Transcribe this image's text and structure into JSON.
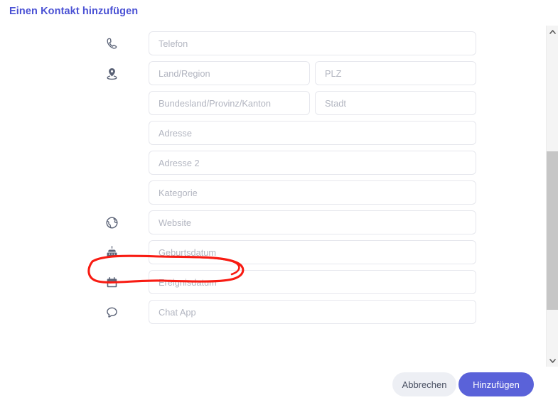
{
  "dialog": {
    "title": "Einen Kontakt hinzufügen"
  },
  "form": {
    "rows": [
      {
        "icon": "phone-icon",
        "fields": [
          {
            "name": "phone-input",
            "placeholder": "Telefon",
            "width": "full"
          }
        ]
      },
      {
        "icon": "location-pin-icon",
        "fields": [
          {
            "name": "country-region-input",
            "placeholder": "Land/Region",
            "width": "left"
          },
          {
            "name": "postal-code-input",
            "placeholder": "PLZ",
            "width": "right"
          }
        ]
      },
      {
        "icon": null,
        "fields": [
          {
            "name": "state-province-input",
            "placeholder": "Bundesland/Provinz/Kanton",
            "width": "left"
          },
          {
            "name": "city-input",
            "placeholder": "Stadt",
            "width": "right"
          }
        ]
      },
      {
        "icon": null,
        "fields": [
          {
            "name": "address-input",
            "placeholder": "Adresse",
            "width": "full"
          }
        ]
      },
      {
        "icon": null,
        "fields": [
          {
            "name": "address-2-input",
            "placeholder": "Adresse 2",
            "width": "full"
          }
        ]
      },
      {
        "icon": null,
        "fields": [
          {
            "name": "category-input",
            "placeholder": "Kategorie",
            "width": "full"
          }
        ]
      },
      {
        "icon": "globe-icon",
        "fields": [
          {
            "name": "website-input",
            "placeholder": "Website",
            "width": "full"
          }
        ]
      },
      {
        "icon": "birthday-cake-icon",
        "fields": [
          {
            "name": "birthday-input",
            "placeholder": "Geburtsdatum",
            "width": "full"
          }
        ]
      },
      {
        "icon": "calendar-icon",
        "fields": [
          {
            "name": "event-date-input",
            "placeholder": "Ereignisdatum",
            "width": "full"
          }
        ]
      },
      {
        "icon": "chat-bubble-icon",
        "fields": [
          {
            "name": "chat-app-input",
            "placeholder": "Chat App",
            "width": "full"
          }
        ]
      }
    ]
  },
  "footer": {
    "cancel_label": "Abbrechen",
    "submit_label": "Hinzufügen"
  },
  "scrollbar": {
    "up_arrow_icon": "chevron-up-icon",
    "down_arrow_icon": "chevron-down-icon"
  },
  "annotation": {
    "type": "hand-drawn-ellipse",
    "color": "#f81b12",
    "target": "birthday-input"
  },
  "colors": {
    "title": "#4a51d4",
    "primary_button": "#5a62d9",
    "cancel_button": "#edeff4",
    "field_border": "#e6e7ed",
    "placeholder": "#b2b5c0",
    "icon": "#5b6377",
    "annotation": "#f81b12"
  }
}
